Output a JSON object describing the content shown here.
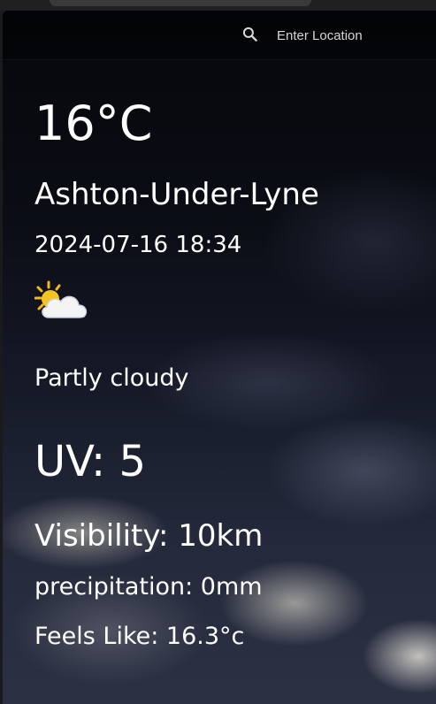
{
  "search": {
    "placeholder": "Enter Location",
    "value": ""
  },
  "weather": {
    "temperature": "16°C",
    "location": "Ashton-Under-Lyne",
    "datetime": "2024-07-16 18:34",
    "condition_icon": "sun-behind-cloud-icon",
    "condition": "Partly cloudy",
    "uv": "UV: 5",
    "visibility": "Visibility: 10km",
    "precipitation": "precipitation: 0mm",
    "feels_like": "Feels Like: 16.3°c"
  },
  "colors": {
    "text": "#ffffff",
    "sun": "#f5c518",
    "cloud": "#f2f2f2"
  }
}
